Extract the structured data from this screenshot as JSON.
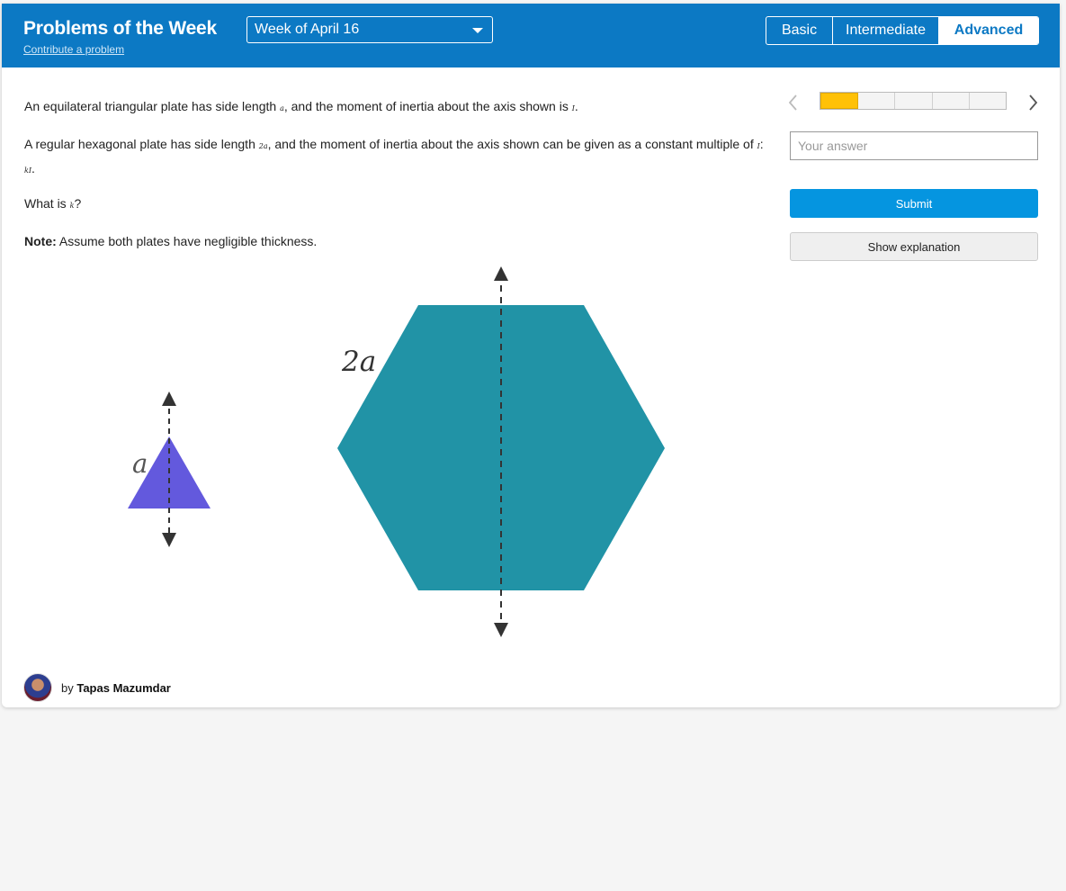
{
  "header": {
    "title": "Problems of the Week",
    "contribute_link": "Contribute a problem",
    "week_selected": "Week of April 16",
    "levels": [
      "Basic",
      "Intermediate",
      "Advanced"
    ],
    "active_level": "Advanced"
  },
  "problem": {
    "p1_a": "An equilateral triangular plate has side length ",
    "p1_var_a": "a",
    "p1_b": ", and the moment of inertia about the axis shown is ",
    "p1_var_I": "I",
    "p1_c": ".",
    "p2_a": "A regular hexagonal plate has side length ",
    "p2_var": "2a",
    "p2_b": ", and the moment of inertia about the axis shown can be given as a constant multiple of ",
    "p2_var_I": "I",
    "p2_c": ": ",
    "p2_var_kI": "kI",
    "p2_d": ".",
    "p3_a": "What is ",
    "p3_var": "k",
    "p3_b": "?",
    "note_label": "Note:",
    "note_text": " Assume both plates have negligible thickness."
  },
  "figure": {
    "triangle_label": "a",
    "hexagon_label": "2a",
    "triangle_color": "#6359dd",
    "hexagon_color": "#2193a6"
  },
  "sidebar": {
    "progress_segments": 5,
    "progress_active_index": 0,
    "answer_placeholder": "Your answer",
    "submit_label": "Submit",
    "explain_label": "Show explanation"
  },
  "author": {
    "by": "by ",
    "name": "Tapas Mazumdar"
  },
  "colors": {
    "header_bg": "#0c79c4",
    "submit_bg": "#0595e0",
    "progress_active": "#ffc107"
  }
}
